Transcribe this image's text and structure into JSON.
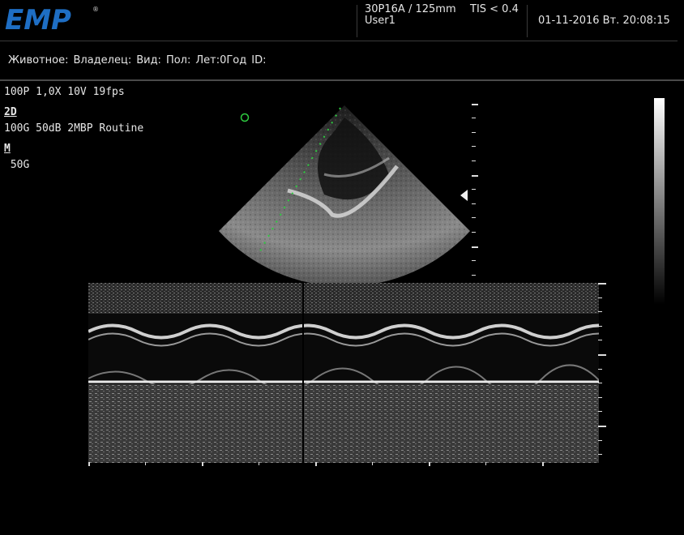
{
  "brand": {
    "logo_text": "EMP",
    "registered_mark": "®",
    "brand_color": "#1e6ec4"
  },
  "header": {
    "probe": "30P16A / 125mm",
    "tis": "TIS < 0.4",
    "user": "User1",
    "datetime": "01-11-2016 Вт. 20:08:15"
  },
  "patient_bar": {
    "fields": [
      "Животное:",
      "Владелец:",
      "Вид:",
      "Пол:",
      "Лет:0Год",
      "ID:"
    ]
  },
  "imaging_params": {
    "line1": "100P 1,0X 10V  19fps",
    "mode_2d_label": "2D",
    "mode_2d_params": "100G 50dB 2MBP Routine",
    "mode_m_label": "M",
    "mode_m_gain": " 50G"
  },
  "icons": {
    "focus_marker": "focus-triangle-icon",
    "cursor_marker": "circle-marker-icon"
  }
}
